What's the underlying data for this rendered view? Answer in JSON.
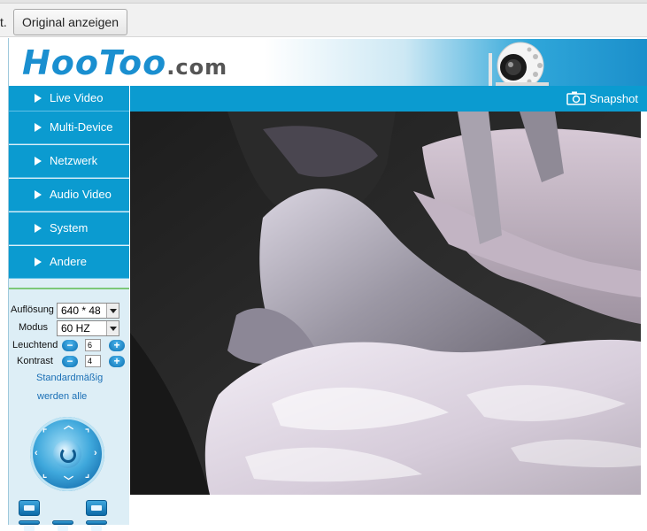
{
  "translate_bar": {
    "text_fragment": "t.",
    "show_original_label": "Original anzeigen"
  },
  "header": {
    "logo_main": "HooToo",
    "logo_domain": ".com"
  },
  "toolbar": {
    "snapshot_label": "Snapshot"
  },
  "sidebar": {
    "items": [
      {
        "label": "Live Video"
      },
      {
        "label": "Multi-Device"
      },
      {
        "label": "Netzwerk"
      },
      {
        "label": "Audio Video"
      },
      {
        "label": "System"
      },
      {
        "label": "Andere"
      }
    ]
  },
  "controls": {
    "resolution_label": "Auflösung",
    "resolution_value": "640 * 48",
    "mode_label": "Modus",
    "mode_value": "60 HZ",
    "brightness_label": "Leuchtend",
    "brightness_value": "6",
    "contrast_label": "Kontrast",
    "contrast_value": "4",
    "reset_line1": "Standardmäßig",
    "reset_line2": "werden alle"
  },
  "colors": {
    "brand_blue": "#0b9bd0",
    "logo_blue": "#1a8fd0",
    "sidebar_bg": "#ddeef6",
    "separator_green": "#7cc879"
  }
}
